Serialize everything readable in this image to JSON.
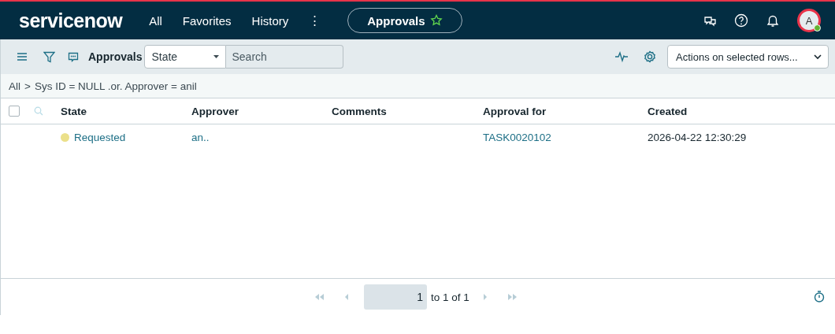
{
  "header": {
    "logo": "servicenow",
    "nav": [
      {
        "label": "All"
      },
      {
        "label": "Favorites"
      },
      {
        "label": "History"
      },
      {
        "label": "⋮"
      }
    ],
    "context_pill": {
      "label": "Approvals",
      "starred": false
    },
    "avatar": {
      "initial": "A"
    }
  },
  "toolbar": {
    "title": "Approvals",
    "search_field": {
      "value": "State"
    },
    "search": {
      "placeholder": "Search"
    },
    "actions": {
      "value": "Actions on selected rows..."
    }
  },
  "breadcrumb": {
    "items": [
      "All",
      "Sys ID = NULL .or. Approver = anil"
    ],
    "separator": ">"
  },
  "table": {
    "all_selected": false,
    "columns": [
      "State",
      "Approver",
      "Comments",
      "Approval for",
      "Created"
    ],
    "rows": [
      {
        "state": {
          "label": "Requested",
          "color": "#ebe08a"
        },
        "approver": "an..",
        "approval_for": "TASK0020102",
        "created": "2026-04-22 12:30:29"
      }
    ]
  },
  "pagination": {
    "page": "1",
    "range": "to 1 of 1"
  }
}
